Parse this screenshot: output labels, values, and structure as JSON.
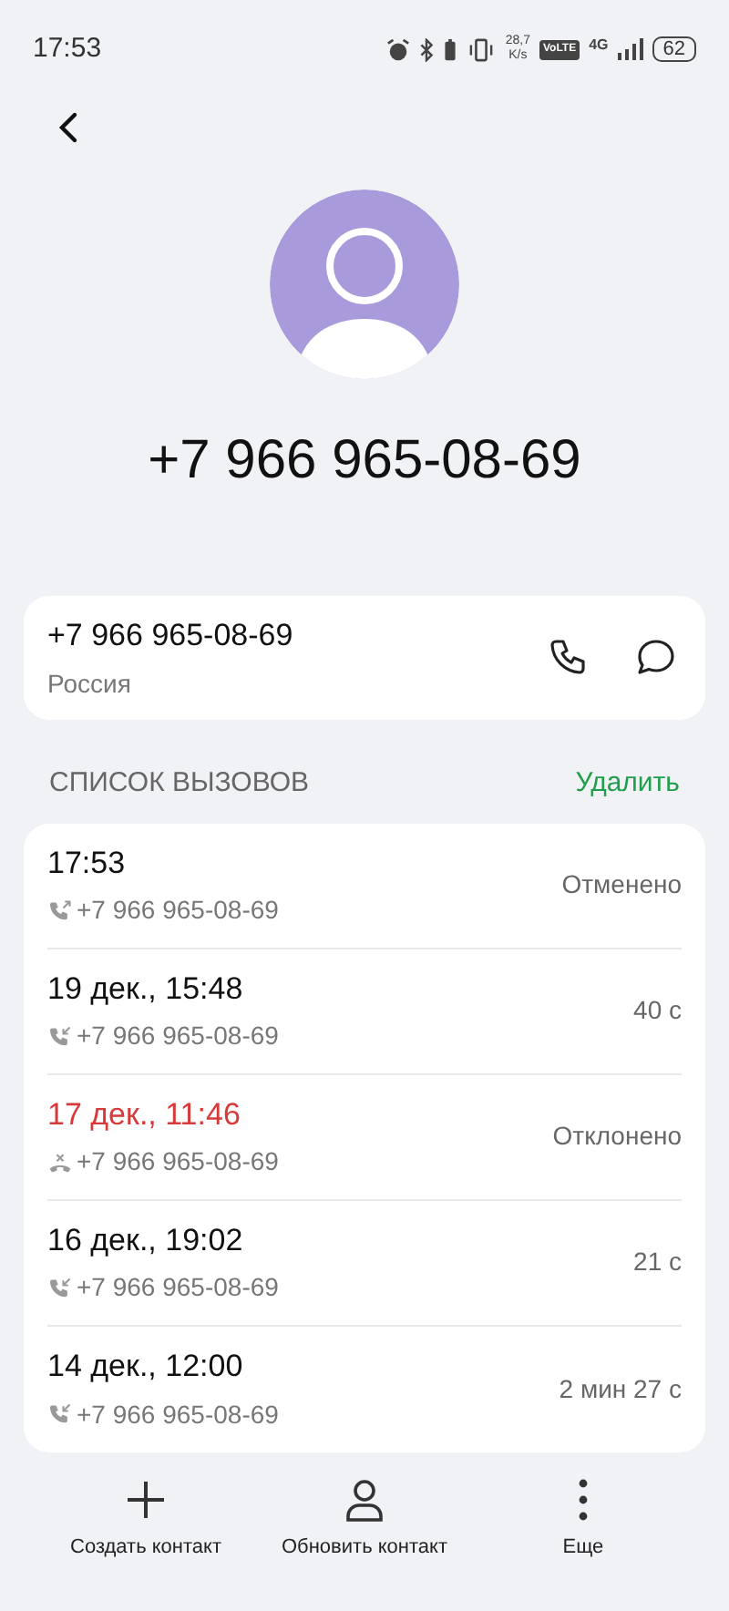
{
  "status_bar": {
    "time": "17:53",
    "speed_value": "28,7",
    "speed_unit": "K/s",
    "network_badge": "VoLTE",
    "network_type": "4G",
    "battery": "62"
  },
  "contact": {
    "title": "+7 966 965-08-69",
    "number": "+7 966 965-08-69",
    "region": "Россия"
  },
  "call_log": {
    "heading": "СПИСОК ВЫЗОВОВ",
    "action": "Удалить",
    "calls": [
      {
        "kind": "outgoing",
        "when": "17:53",
        "number": "+7 966 965-08-69",
        "result": "Отменено"
      },
      {
        "kind": "incoming",
        "when": "19 дек., 15:48",
        "number": "+7 966 965-08-69",
        "result": "40 с"
      },
      {
        "kind": "rejected",
        "when": "17 дек., 11:46",
        "number": "+7 966 965-08-69",
        "result": "Отклонено"
      },
      {
        "kind": "incoming",
        "when": "16 дек., 19:02",
        "number": "+7 966 965-08-69",
        "result": "21 с"
      },
      {
        "kind": "incoming",
        "when": "14 дек., 12:00",
        "number": "+7 966 965-08-69",
        "result": "2 мин 27 с"
      }
    ]
  },
  "bottom_actions": [
    {
      "kind": "add",
      "label": "Создать контакт"
    },
    {
      "kind": "person",
      "label": "Обновить контакт"
    },
    {
      "kind": "more",
      "label": "Еще"
    }
  ]
}
